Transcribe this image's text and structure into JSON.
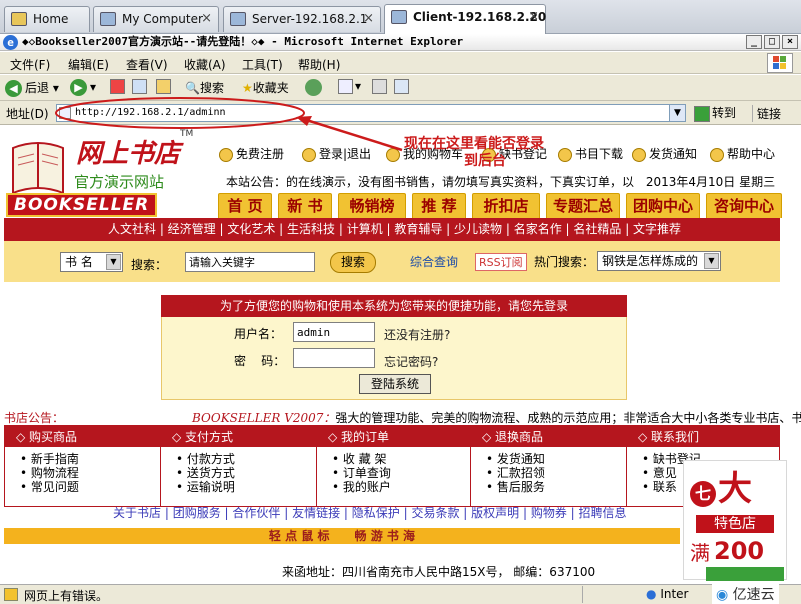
{
  "host_tabs": [
    {
      "label": "Home"
    },
    {
      "label": "My Computer"
    },
    {
      "label": "Server-192.168.2.1"
    },
    {
      "label": "Client-192.168.2.20"
    }
  ],
  "window": {
    "title": "◆◇Bookseller2007官方演示站--请先登陆！◇◆ - Microsoft Internet Explorer",
    "min": "_",
    "max": "□",
    "close": "×"
  },
  "menubar": [
    "文件(F)",
    "编辑(E)",
    "查看(V)",
    "收藏(A)",
    "工具(T)",
    "帮助(H)"
  ],
  "toolbar": {
    "back": "后退",
    "search": "搜索",
    "favorites": "收藏夹"
  },
  "address": {
    "label": "地址(D)",
    "url": "http://192.168.2.1/adminn",
    "go": "转到",
    "links": "链接"
  },
  "annotation": {
    "line1": "现在在这里看能否登录",
    "line2": "到后台"
  },
  "site": {
    "logo_title": "网上书店",
    "logo_tm": "TM",
    "logo_sub": "官方演示网站",
    "logo_en": "BOOKSELLER",
    "top_nav": [
      "免费注册",
      "登录|退出",
      "我的购物车",
      "缺书登记",
      "书目下载",
      "发货通知",
      "帮助中心"
    ],
    "notice": "本站公告：的在线演示，没有图书销售，请勿填写真实资料，下真实订单，以",
    "date": "2013年4月10日 星期三",
    "main_tabs": [
      "首 页",
      "新 书",
      "畅销榜",
      "推 荐",
      "折扣店",
      "专题汇总",
      "团购中心",
      "咨询中心"
    ],
    "categories": "人文社科 | 经济管理 | 文化艺术 | 生活科技 | 计算机 | 教育辅导 | 少儿读物 | 名家名作 | 名社精品 | 文字推荐",
    "search": {
      "field_select": "书 名",
      "label": "搜索：",
      "placeholder": "请输入关键字",
      "button": "搜索",
      "advanced": "综合查询",
      "rss": "RSS订阅",
      "hot_label": "热门搜索：",
      "hot_value": "钢铁是怎样炼成的"
    },
    "login": {
      "header": "为了方便您的购物和使用本系统为您带来的便捷功能，请您先登录",
      "username_label": "用户名：",
      "username_value": "admin",
      "register_link": "还没有注册?",
      "password_label": "密    码：",
      "forgot_link": "忘记密码?",
      "submit": "登陆系统"
    },
    "shop_notice_label": "书店公告：",
    "marquee_brand": "BOOKSELLER V2007：",
    "marquee_text": "强大的管理功能、完美的购物流程、成熟的示范应用；非常适合大中小各类专业书店、书商、",
    "footer_cols": [
      {
        "title": "购买商品",
        "items": [
          "新手指南",
          "购物流程",
          "常见问题"
        ]
      },
      {
        "title": "支付方式",
        "items": [
          "付款方式",
          "送货方式",
          "运输说明"
        ]
      },
      {
        "title": "我的订单",
        "items": [
          "收 藏 架",
          "订单查询",
          "我的账户"
        ]
      },
      {
        "title": "退换商品",
        "items": [
          "发货通知",
          "汇款招领",
          "售后服务"
        ]
      },
      {
        "title": "联系我们",
        "items": [
          "缺书登记",
          "意见",
          "联系"
        ]
      }
    ],
    "footer_links": [
      "关于书店",
      "团购服务",
      "合作伙伴",
      "友情链接",
      "隐私保护",
      "交易条款",
      "版权声明",
      "购物券",
      "招聘信息"
    ],
    "slogan": "轻 点 鼠 标      畅 游 书 海",
    "address_line": "来函地址：四川省南充市人民中路15X号，  邮编：637100",
    "ad": {
      "circle": "七",
      "big": "大",
      "line2": "特色店",
      "line3_a": "满",
      "line3_b": "200"
    }
  },
  "statusbar": {
    "text": "网页上有错误。",
    "zone": "Inter",
    "watermark": "亿速云"
  },
  "colors": {
    "brand_red": "#b5161e",
    "gold": "#f1c232",
    "annotation_red": "#cc1b1b"
  }
}
